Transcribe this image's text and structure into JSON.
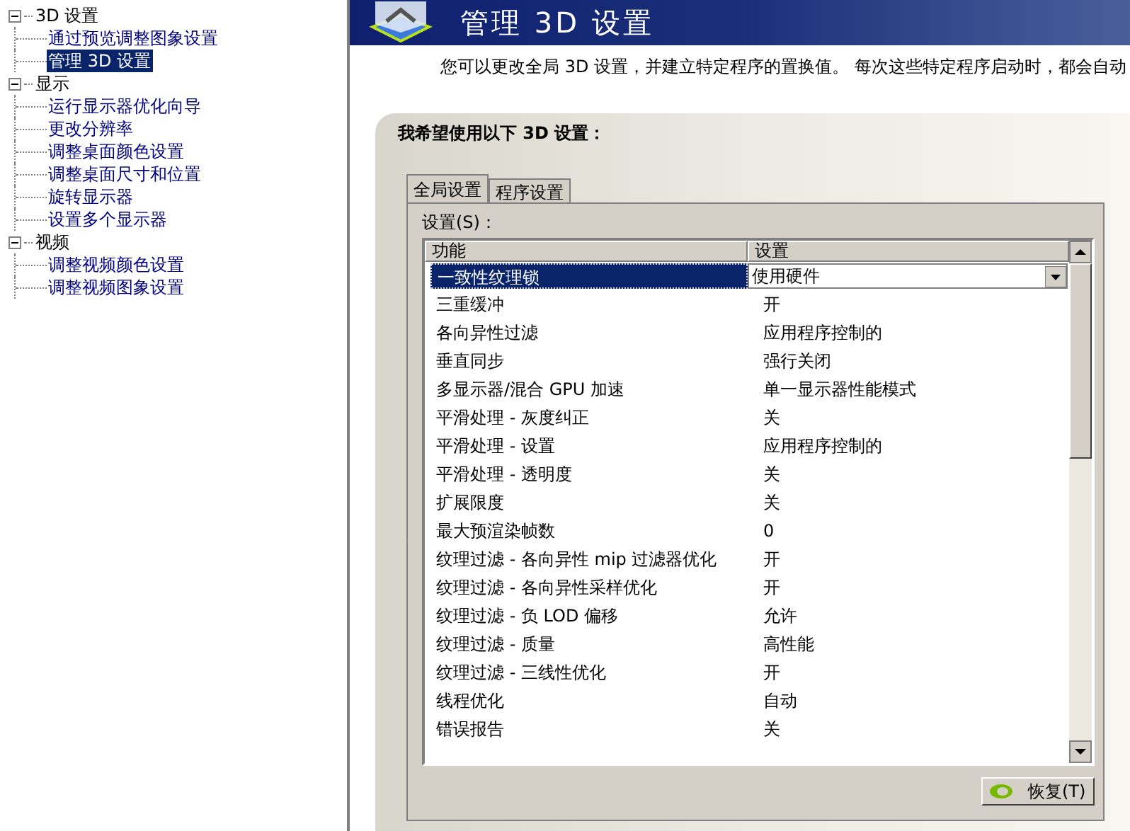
{
  "sidebar": {
    "tree": [
      {
        "label": "3D 设置",
        "expanded": true,
        "children": [
          {
            "label": "通过预览调整图象设置",
            "selected": false
          },
          {
            "label": "管理 3D 设置",
            "selected": true
          }
        ]
      },
      {
        "label": "显示",
        "expanded": true,
        "children": [
          {
            "label": "运行显示器优化向导",
            "selected": false
          },
          {
            "label": "更改分辨率",
            "selected": false
          },
          {
            "label": "调整桌面颜色设置",
            "selected": false
          },
          {
            "label": "调整桌面尺寸和位置",
            "selected": false
          },
          {
            "label": "旋转显示器",
            "selected": false
          },
          {
            "label": "设置多个显示器",
            "selected": false
          }
        ]
      },
      {
        "label": "视频",
        "expanded": true,
        "children": [
          {
            "label": "调整视频颜色设置",
            "selected": false
          },
          {
            "label": "调整视频图象设置",
            "selected": false
          }
        ]
      }
    ]
  },
  "header": {
    "title": "管理 3D 设置",
    "description": "您可以更改全局 3D 设置，并建立特定程序的置换值。 每次这些特定程序启动时，都会自动"
  },
  "panel": {
    "heading": "我希望使用以下 3D 设置：",
    "tabs": [
      {
        "label": "全局设置",
        "selected": true
      },
      {
        "label": "程序设置",
        "selected": false
      }
    ],
    "settings_label": "设置(S)：",
    "table": {
      "columns": [
        "功能",
        "设置"
      ],
      "rows": [
        {
          "feature": "一致性纹理锁",
          "value": "使用硬件",
          "selected": true
        },
        {
          "feature": "三重缓冲",
          "value": "开",
          "selected": false
        },
        {
          "feature": "各向异性过滤",
          "value": "应用程序控制的",
          "selected": false
        },
        {
          "feature": "垂直同步",
          "value": "强行关闭",
          "selected": false
        },
        {
          "feature": "多显示器/混合 GPU 加速",
          "value": "单一显示器性能模式",
          "selected": false
        },
        {
          "feature": "平滑处理 - 灰度纠正",
          "value": "关",
          "selected": false
        },
        {
          "feature": "平滑处理 - 设置",
          "value": "应用程序控制的",
          "selected": false
        },
        {
          "feature": "平滑处理 - 透明度",
          "value": "关",
          "selected": false
        },
        {
          "feature": "扩展限度",
          "value": "关",
          "selected": false
        },
        {
          "feature": "最大预渲染帧数",
          "value": "0",
          "selected": false
        },
        {
          "feature": "纹理过滤 - 各向异性 mip 过滤器优化",
          "value": "开",
          "selected": false
        },
        {
          "feature": "纹理过滤 - 各向异性采样优化",
          "value": "开",
          "selected": false
        },
        {
          "feature": "纹理过滤 - 负 LOD 偏移",
          "value": "允许",
          "selected": false
        },
        {
          "feature": "纹理过滤 - 质量",
          "value": "高性能",
          "selected": false
        },
        {
          "feature": "纹理过滤 - 三线性优化",
          "value": "开",
          "selected": false
        },
        {
          "feature": "线程优化",
          "value": "自动",
          "selected": false
        },
        {
          "feature": "错误报告",
          "value": "关",
          "selected": false
        }
      ]
    },
    "restore_button": "恢复(T)"
  }
}
